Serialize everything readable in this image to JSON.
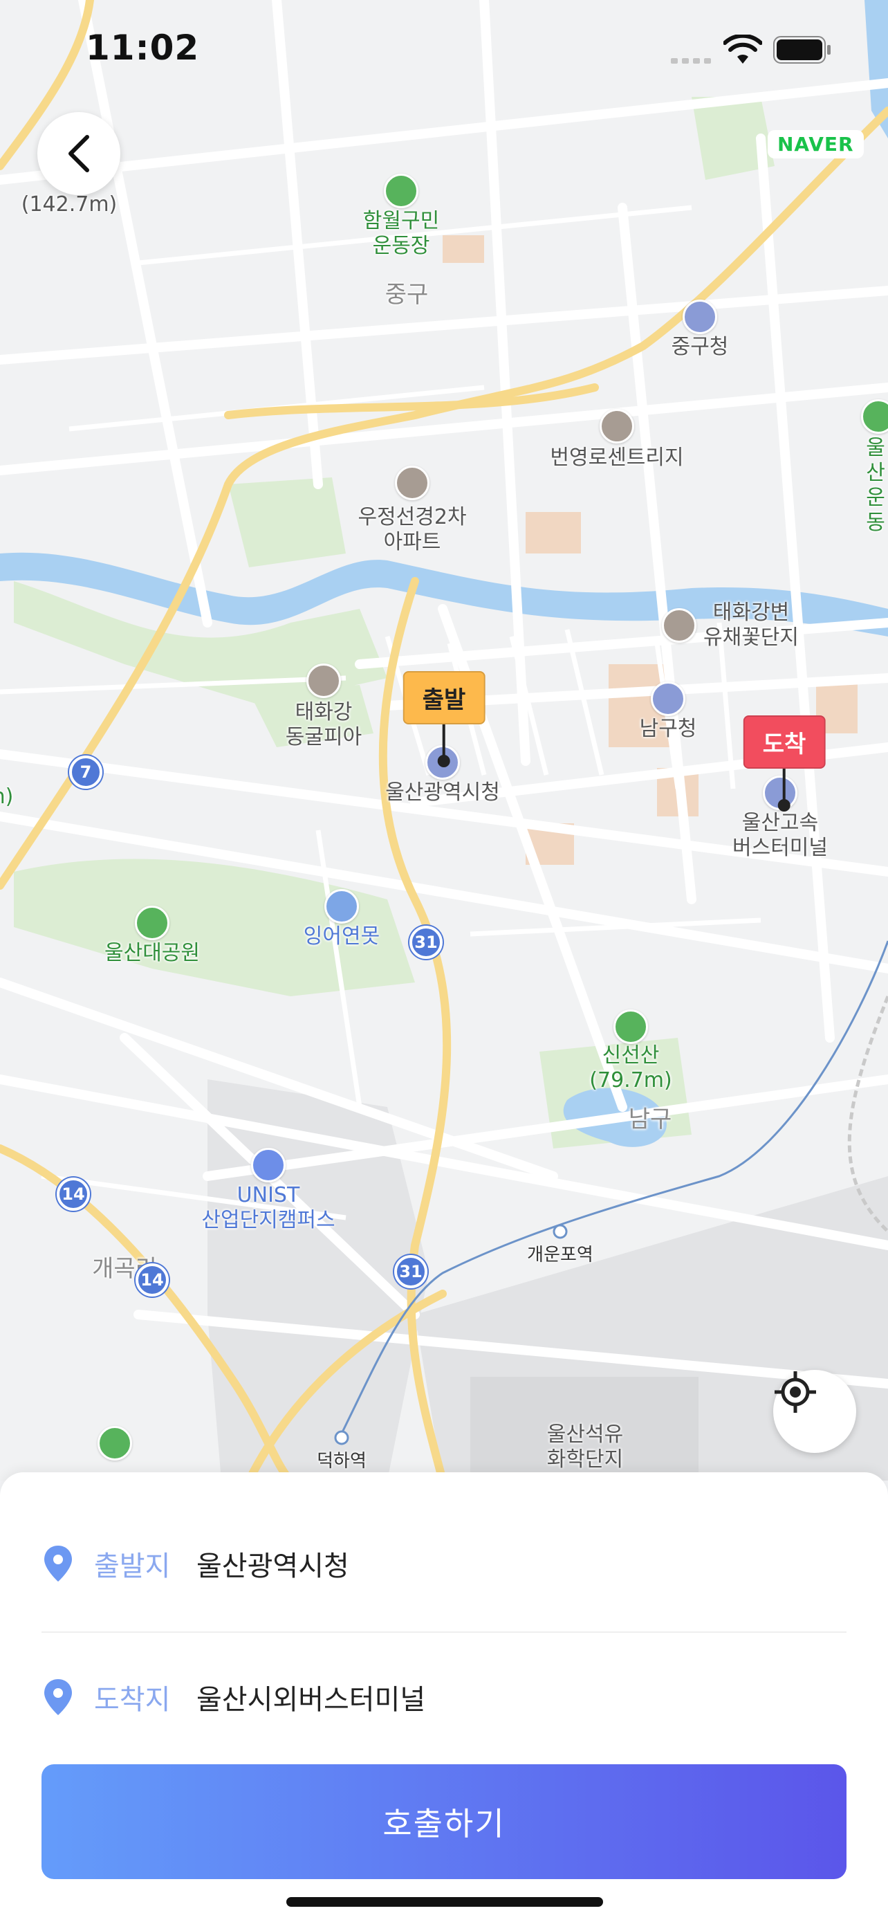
{
  "status_bar": {
    "time": "11:02"
  },
  "map": {
    "provider": "NAVER",
    "labels": {
      "hamwol": "함월구민\n운동장",
      "junggu_district": "중구",
      "junggu_office": "중구청",
      "bridge": "번영로센트리지",
      "woojeong": "우정선경2차\n아파트",
      "park_right": "울산\n운동",
      "taehwa_flower": "태화강변\n유채꽃단지",
      "taehwa_cave": "태화강\n동굴피아",
      "namgu_office": "남구청",
      "city_hall": "울산광역시청",
      "terminal": "울산고속\n버스터미널",
      "grand_park": "울산대공원",
      "pond": "잉어연못",
      "sinseon": "신선산\n(79.7m)",
      "namgu_district": "남구",
      "unist": "UNIST\n산업단지캠퍼스",
      "gaegok": "개곡리",
      "gaeunpo": "개운포역",
      "deokha": "덕하역",
      "petro": "울산석유\n화학단지",
      "height_left": "(142.7m)",
      "partial_m": "n)"
    },
    "route_numbers": {
      "r7": "7",
      "r31a": "31",
      "r31b": "31",
      "r14a": "14",
      "r14b": "14"
    },
    "markers": {
      "start": "출발",
      "end": "도착"
    }
  },
  "trip": {
    "origin": {
      "label": "출발지",
      "value": "울산광역시청"
    },
    "destination": {
      "label": "도착지",
      "value": "울산시외버스터미널"
    }
  },
  "call_button": "호출하기",
  "colors": {
    "start_tag": "#fdb94c",
    "end_tag": "#f24d5e",
    "accent": "#8aa8ef",
    "button_from": "#649cfa",
    "button_to": "#5b56ea"
  }
}
